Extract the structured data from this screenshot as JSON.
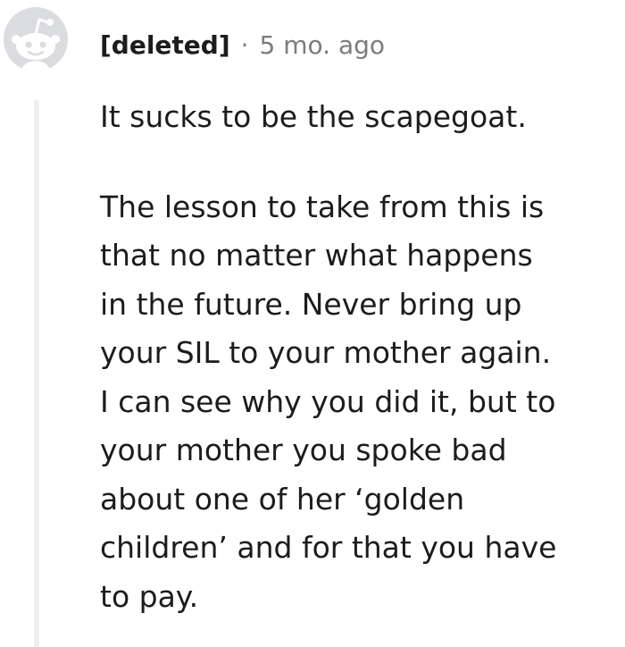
{
  "comment": {
    "author": "[deleted]",
    "separator": "·",
    "timestamp": "5 mo. ago",
    "paragraphs": [
      {
        "lines": [
          "It sucks to be the scapegoat."
        ]
      },
      {
        "lines": [
          "The lesson to take from this is",
          "that no matter what happens",
          "in the future. Never bring up",
          "your SIL to your mother again.",
          "I can see why you did it, but to",
          "your mother you spoke bad",
          "about one of her ‘golden",
          "children’ and for that you have",
          "to pay."
        ]
      }
    ]
  },
  "colors": {
    "avatar_bg": "#dadcdf",
    "avatar_fg": "#ffffff",
    "meta_text": "#7c7c7c",
    "body_text": "#1c1c1c",
    "thread_line": "#edeff1"
  },
  "icons": {
    "avatar": "reddit-snoo-icon"
  }
}
